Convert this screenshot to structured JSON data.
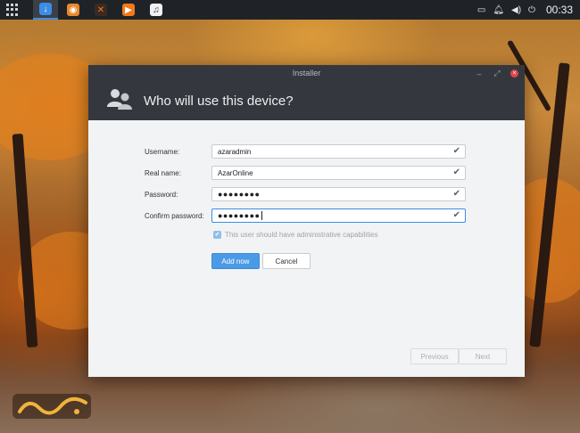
{
  "topbar": {
    "clock": "00:33",
    "taskbar_apps": [
      {
        "name": "installer",
        "color": "#3a8ee6",
        "glyph": "↓"
      },
      {
        "name": "firefox",
        "color": "#e8892b",
        "glyph": "◉"
      },
      {
        "name": "app-orange",
        "color": "#e05a1a",
        "glyph": "✕"
      },
      {
        "name": "media-player",
        "color": "#f07a1a",
        "glyph": "▶"
      },
      {
        "name": "music",
        "color": "#f1f1f1",
        "glyph": "♫"
      }
    ]
  },
  "window": {
    "title": "Installer",
    "heading": "Who will use this device?",
    "controls": {
      "minimize": "–",
      "restore": "⤢",
      "close": "×"
    }
  },
  "form": {
    "username": {
      "label": "Username:",
      "value": "azaradmin"
    },
    "realname": {
      "label": "Real name:",
      "value": "AzarOnline"
    },
    "password": {
      "label": "Password:",
      "value": "●●●●●●●●"
    },
    "confirm": {
      "label": "Confirm password:",
      "value": "●●●●●●●●"
    },
    "admin_label": "This user should have administrative capabilities",
    "admin_checked": true,
    "add_label": "Add now",
    "cancel_label": "Cancel"
  },
  "nav": {
    "previous_label": "Previous",
    "next_label": "Next"
  },
  "colors": {
    "accent": "#4a9ae6",
    "header": "#34383e",
    "topbar": "#1f2328"
  }
}
